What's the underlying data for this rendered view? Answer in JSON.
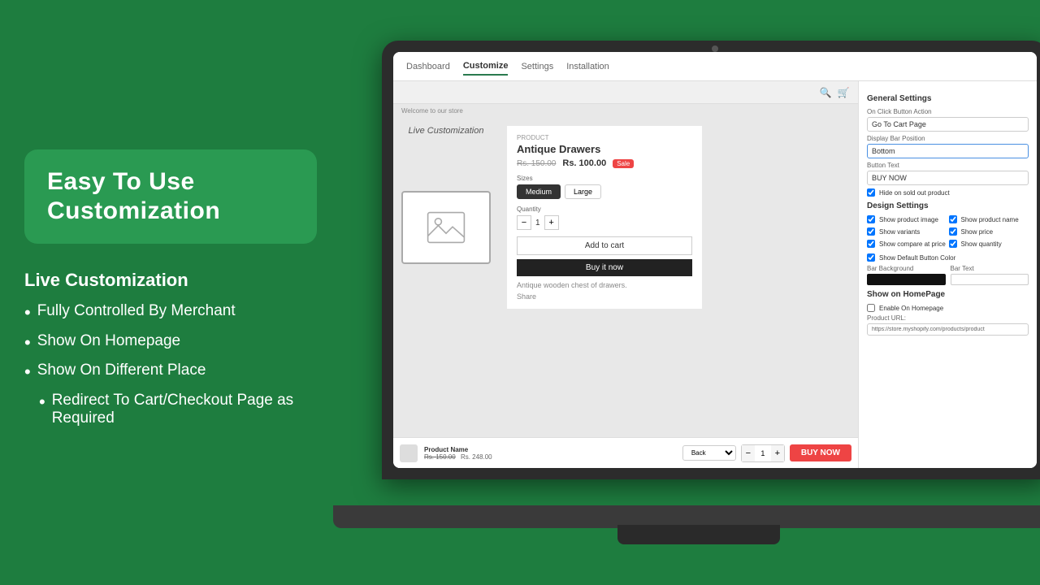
{
  "background": {
    "color": "#1e7d3f"
  },
  "title_box": {
    "text": "Easy To Use Customization"
  },
  "features": {
    "heading": "Live Customization",
    "items": [
      "Fully Controlled By Merchant",
      "Show On Homepage",
      "Show On Different Place",
      "Redirect To Cart/Checkout Page as Required"
    ]
  },
  "nav": {
    "tabs": [
      "Dashboard",
      "Customize",
      "Settings",
      "Installation"
    ],
    "active": "Customize"
  },
  "product": {
    "name": "Antique Drawers",
    "original_price": "Rs. 150.00",
    "current_price": "Rs. 100.00",
    "badge": "Sale",
    "sizes": [
      "Medium",
      "Large"
    ],
    "active_size": "Medium",
    "quantity": "1",
    "description": "Antique wooden chest of drawers.",
    "add_to_cart": "Add to cart",
    "buy_now": "Buy it now",
    "share": "Share"
  },
  "live_label": "Live Customization",
  "sticky_bar": {
    "product_name": "Product Name",
    "price_original": "Rs. 150.00",
    "price_current": "Rs. 248.00",
    "back_label": "Back",
    "quantity": "1",
    "buy_btn": "BUY NOW"
  },
  "settings": {
    "general_title": "General Settings",
    "on_click_label": "On Click Button Action",
    "on_click_value": "Go To Cart Page",
    "display_bar_label": "Display Bar Position",
    "display_bar_value": "Bottom",
    "button_text_label": "Button Text",
    "button_text_value": "BUY NOW",
    "hide_sold_out": "Hide on sold out product",
    "design_title": "Design Settings",
    "design_checkboxes": [
      {
        "label": "Show product image",
        "checked": true
      },
      {
        "label": "Show product name",
        "checked": true
      },
      {
        "label": "Show variants",
        "checked": true
      },
      {
        "label": "Show price",
        "checked": true
      },
      {
        "label": "Show compare at price",
        "checked": true
      },
      {
        "label": "Show quantity",
        "checked": true
      },
      {
        "label": "Show Default Button Color",
        "checked": true
      }
    ],
    "bar_background_label": "Bar Background",
    "bar_text_label": "Bar Text",
    "show_on_homepage_title": "Show on HomePage",
    "enable_homepage_label": "Enable On Homepage",
    "product_url_label": "Product URL:",
    "product_url_value": "https://store.myshopify.com/products/product"
  }
}
